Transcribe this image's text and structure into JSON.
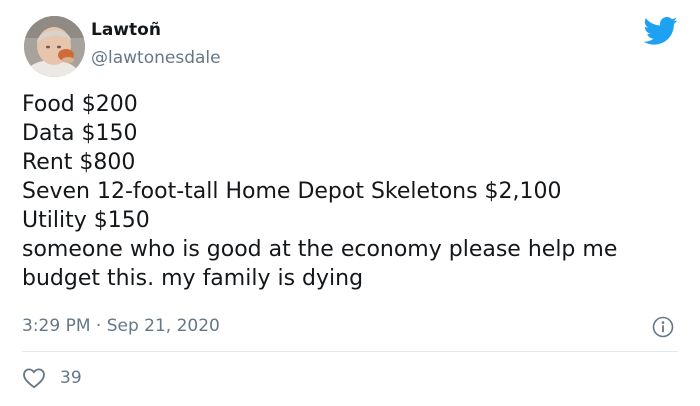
{
  "tweet": {
    "author": {
      "name": "Lawtoñ",
      "handle": "@lawtonesdale",
      "avatar_icon": "profile-photo"
    },
    "lines": [
      "Food $200",
      "Data $150",
      "Rent $800",
      "Seven 12-foot-tall Home Depot Skeletons $2,100",
      "Utility $150",
      "someone who is good at the economy please help me",
      "budget this. my family is dying"
    ],
    "timestamp": "3:29 PM · Sep 21, 2020",
    "likes": "39"
  },
  "icons": {
    "logo": "twitter-bird-icon",
    "info": "info-icon",
    "like": "heart-icon"
  },
  "colors": {
    "brand": "#1da1f2",
    "text": "#14171a",
    "secondary": "#657786",
    "divider": "#e1e8ed"
  }
}
